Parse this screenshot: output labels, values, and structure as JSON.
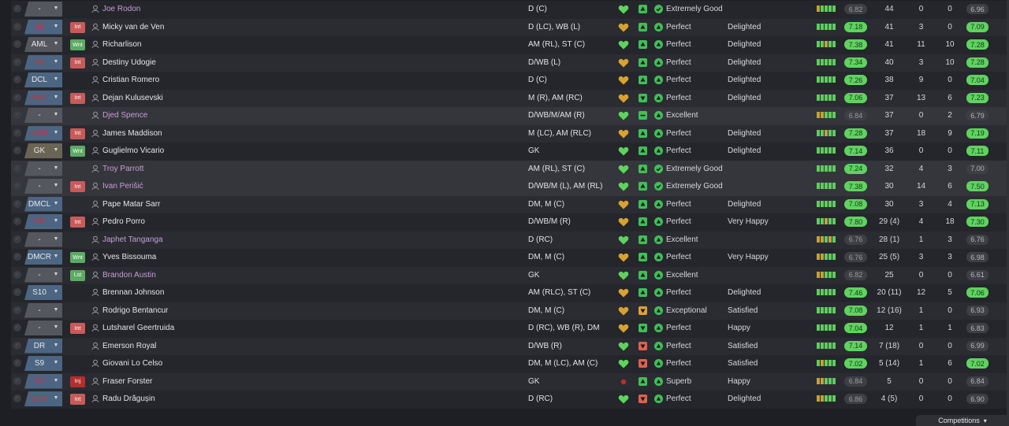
{
  "colors": {
    "heart": "#5ed35e",
    "heart_amber": "#d9a230",
    "morale_green": "#3fbf58",
    "morale_red": "#e06050",
    "morale_amber": "#e0a030",
    "rating_green": "#5fd35f",
    "loan_name": "#c89ed8"
  },
  "footer": {
    "competitions_label": "Competitions"
  },
  "rows": [
    {
      "position": "-",
      "pos_style": "grey",
      "badge": "",
      "name": "Joe Rodon",
      "loan": true,
      "positions": "D (C)",
      "heart": "green",
      "morale": "up",
      "morale_color": "green",
      "cond_icon": "check",
      "condition": "Extremely Good",
      "happiness": "",
      "form": [
        "y",
        "g",
        "g",
        "g",
        "g"
      ],
      "rating": "6.82",
      "rating_hi": false,
      "apps": "44",
      "goals": "0",
      "assists": "0",
      "avg": "6.96",
      "avg_hi": false
    },
    {
      "position": "SB",
      "pos_style": "red",
      "badge": "Int",
      "name": "Micky van de Ven",
      "loan": false,
      "positions": "D (LC), WB (L)",
      "heart": "amber",
      "morale": "up",
      "morale_color": "green",
      "cond_icon": "up",
      "condition": "Perfect",
      "happiness": "Delighted",
      "form": [
        "g",
        "g",
        "g",
        "g",
        "g"
      ],
      "rating": "7.18",
      "rating_hi": true,
      "apps": "41",
      "goals": "3",
      "assists": "0",
      "avg": "7.09",
      "avg_hi": true
    },
    {
      "position": "AML",
      "pos_style": "grey",
      "badge": "Wnt",
      "name": "Richarlison",
      "loan": false,
      "positions": "AM (RL), ST (C)",
      "heart": "green",
      "morale": "up",
      "morale_color": "green",
      "cond_icon": "up",
      "condition": "Perfect",
      "happiness": "Delighted",
      "form": [
        "g",
        "g",
        "y",
        "g",
        "g"
      ],
      "rating": "7.38",
      "rating_hi": true,
      "apps": "41",
      "goals": "11",
      "assists": "10",
      "avg": "7.28",
      "avg_hi": true
    },
    {
      "position": "IW",
      "pos_style": "red",
      "badge": "Int",
      "name": "Destiny Udogie",
      "loan": false,
      "positions": "D/WB (L)",
      "heart": "amber",
      "morale": "up",
      "morale_color": "green",
      "cond_icon": "up",
      "condition": "Perfect",
      "happiness": "Delighted",
      "form": [
        "g",
        "g",
        "g",
        "g",
        "g"
      ],
      "rating": "7.34",
      "rating_hi": true,
      "apps": "40",
      "goals": "3",
      "assists": "10",
      "avg": "7.28",
      "avg_hi": true
    },
    {
      "position": "DCL",
      "pos_style": "blue",
      "badge": "",
      "name": "Cristian Romero",
      "loan": false,
      "positions": "D (C)",
      "heart": "amber",
      "morale": "up",
      "morale_color": "green",
      "cond_icon": "up",
      "condition": "Perfect",
      "happiness": "Delighted",
      "form": [
        "g",
        "g",
        "g",
        "g",
        "g"
      ],
      "rating": "7.26",
      "rating_hi": true,
      "apps": "38",
      "goals": "9",
      "assists": "0",
      "avg": "7.04",
      "avg_hi": true
    },
    {
      "position": "AMC",
      "pos_style": "red",
      "badge": "Int",
      "name": "Dejan Kulusevski",
      "loan": false,
      "positions": "M (R), AM (RC)",
      "heart": "amber",
      "morale": "down",
      "morale_color": "green",
      "cond_icon": "up",
      "condition": "Perfect",
      "happiness": "Delighted",
      "form": [
        "g",
        "g",
        "g",
        "g",
        "g"
      ],
      "rating": "7.06",
      "rating_hi": true,
      "apps": "37",
      "goals": "13",
      "assists": "6",
      "avg": "7.23",
      "avg_hi": true
    },
    {
      "position": "-",
      "pos_style": "grey",
      "badge": "",
      "name": "Djed Spence",
      "loan": true,
      "positions": "D/WB/M/AM (R)",
      "heart": "green",
      "morale": "flat",
      "morale_color": "green",
      "cond_icon": "up",
      "condition": "Excellent",
      "happiness": "",
      "form": [
        "y",
        "y",
        "g",
        "g",
        "g"
      ],
      "rating": "6.84",
      "rating_hi": false,
      "apps": "37",
      "goals": "0",
      "assists": "2",
      "avg": "6.79",
      "avg_hi": false
    },
    {
      "position": "AMR",
      "pos_style": "red",
      "badge": "Int",
      "name": "James Maddison",
      "loan": false,
      "positions": "M (LC), AM (RLC)",
      "heart": "amber",
      "morale": "up",
      "morale_color": "green",
      "cond_icon": "up",
      "condition": "Perfect",
      "happiness": "Delighted",
      "form": [
        "g",
        "g",
        "y",
        "g",
        "g"
      ],
      "rating": "7.28",
      "rating_hi": true,
      "apps": "37",
      "goals": "18",
      "assists": "9",
      "avg": "7.19",
      "avg_hi": true
    },
    {
      "position": "GK",
      "pos_style": "brown",
      "badge": "Wnt",
      "name": "Guglielmo Vicario",
      "loan": false,
      "positions": "GK",
      "heart": "green",
      "morale": "up",
      "morale_color": "green",
      "cond_icon": "up",
      "condition": "Perfect",
      "happiness": "Delighted",
      "form": [
        "g",
        "g",
        "g",
        "g",
        "g"
      ],
      "rating": "7.14",
      "rating_hi": true,
      "apps": "36",
      "goals": "0",
      "assists": "0",
      "avg": "7.11",
      "avg_hi": true
    },
    {
      "position": "-",
      "pos_style": "grey",
      "badge": "",
      "name": "Troy Parrott",
      "loan": true,
      "positions": "AM (RL), ST (C)",
      "heart": "green",
      "morale": "up",
      "morale_color": "green",
      "cond_icon": "check",
      "condition": "Extremely Good",
      "happiness": "",
      "form": [
        "g",
        "g",
        "g",
        "g",
        "g"
      ],
      "rating": "7.24",
      "rating_hi": true,
      "apps": "32",
      "goals": "4",
      "assists": "3",
      "avg": "7.00",
      "avg_hi": false
    },
    {
      "position": "-",
      "pos_style": "grey",
      "badge": "Int",
      "name": "Ivan Perišić",
      "loan": true,
      "positions": "D/WB/M (L), AM (RL)",
      "heart": "green",
      "morale": "up",
      "morale_color": "green",
      "cond_icon": "check",
      "condition": "Extremely Good",
      "happiness": "",
      "form": [
        "g",
        "g",
        "g",
        "g",
        "g"
      ],
      "rating": "7.38",
      "rating_hi": true,
      "apps": "30",
      "goals": "14",
      "assists": "6",
      "avg": "7.50",
      "avg_hi": true
    },
    {
      "position": "DMCL",
      "pos_style": "blue",
      "badge": "",
      "name": "Pape Matar Sarr",
      "loan": false,
      "positions": "DM, M (C)",
      "heart": "amber",
      "morale": "up",
      "morale_color": "green",
      "cond_icon": "up",
      "condition": "Perfect",
      "happiness": "Delighted",
      "form": [
        "g",
        "g",
        "g",
        "g",
        "g"
      ],
      "rating": "7.08",
      "rating_hi": true,
      "apps": "30",
      "goals": "3",
      "assists": "4",
      "avg": "7.13",
      "avg_hi": true
    },
    {
      "position": "SB",
      "pos_style": "red",
      "badge": "Int",
      "name": "Pedro Porro",
      "loan": false,
      "positions": "D/WB/M (R)",
      "heart": "amber",
      "morale": "up",
      "morale_color": "green",
      "cond_icon": "up",
      "condition": "Perfect",
      "happiness": "Very Happy",
      "form": [
        "g",
        "g",
        "y",
        "g",
        "g"
      ],
      "rating": "7.80",
      "rating_hi": true,
      "apps": "29 (4)",
      "goals": "4",
      "assists": "18",
      "avg": "7.30",
      "avg_hi": true
    },
    {
      "position": "-",
      "pos_style": "grey",
      "badge": "",
      "name": "Japhet Tanganga",
      "loan": true,
      "positions": "D (RC)",
      "heart": "green",
      "morale": "up",
      "morale_color": "green",
      "cond_icon": "up",
      "condition": "Excellent",
      "happiness": "",
      "form": [
        "y",
        "y",
        "g",
        "y",
        "g"
      ],
      "rating": "6.76",
      "rating_hi": false,
      "apps": "28 (1)",
      "goals": "1",
      "assists": "3",
      "avg": "6.76",
      "avg_hi": false
    },
    {
      "position": "DMCR",
      "pos_style": "blue",
      "badge": "Wnt",
      "name": "Yves Bissouma",
      "loan": false,
      "positions": "DM, M (C)",
      "heart": "amber",
      "morale": "up",
      "morale_color": "green",
      "cond_icon": "up",
      "condition": "Perfect",
      "happiness": "Very Happy",
      "form": [
        "y",
        "y",
        "g",
        "g",
        "g"
      ],
      "rating": "6.76",
      "rating_hi": false,
      "apps": "25 (5)",
      "goals": "3",
      "assists": "3",
      "avg": "6.98",
      "avg_hi": false
    },
    {
      "position": "-",
      "pos_style": "grey",
      "badge": "Lst",
      "name": "Brandon Austin",
      "loan": true,
      "positions": "GK",
      "heart": "green",
      "morale": "up",
      "morale_color": "green",
      "cond_icon": "up",
      "condition": "Excellent",
      "happiness": "",
      "form": [
        "y",
        "y",
        "g",
        "g",
        "g"
      ],
      "rating": "6.82",
      "rating_hi": false,
      "apps": "25",
      "goals": "0",
      "assists": "0",
      "avg": "6.61",
      "avg_hi": false
    },
    {
      "position": "S10",
      "pos_style": "blue",
      "badge": "",
      "name": "Brennan Johnson",
      "loan": false,
      "positions": "AM (RLC), ST (C)",
      "heart": "amber",
      "morale": "up",
      "morale_color": "green",
      "cond_icon": "up",
      "condition": "Perfect",
      "happiness": "Delighted",
      "form": [
        "g",
        "g",
        "g",
        "g",
        "g"
      ],
      "rating": "7.46",
      "rating_hi": true,
      "apps": "20 (11)",
      "goals": "12",
      "assists": "5",
      "avg": "7.06",
      "avg_hi": true
    },
    {
      "position": "-",
      "pos_style": "grey",
      "badge": "",
      "name": "Rodrigo Bentancur",
      "loan": false,
      "positions": "DM, M (C)",
      "heart": "amber",
      "morale": "down",
      "morale_color": "amber",
      "cond_icon": "up",
      "condition": "Exceptional",
      "happiness": "Satisfied",
      "form": [
        "g",
        "g",
        "g",
        "g",
        "g"
      ],
      "rating": "7.08",
      "rating_hi": true,
      "apps": "12 (16)",
      "goals": "1",
      "assists": "0",
      "avg": "6.93",
      "avg_hi": false
    },
    {
      "position": "-",
      "pos_style": "grey",
      "badge": "Int",
      "name": "Lutsharel Geertruida",
      "loan": false,
      "positions": "D (RC), WB (R), DM",
      "heart": "amber",
      "morale": "down",
      "morale_color": "green",
      "cond_icon": "up",
      "condition": "Perfect",
      "happiness": "Happy",
      "form": [
        "g",
        "g",
        "g",
        "g",
        "g"
      ],
      "rating": "7.04",
      "rating_hi": true,
      "apps": "12",
      "goals": "1",
      "assists": "1",
      "avg": "6.83",
      "avg_hi": false
    },
    {
      "position": "DR",
      "pos_style": "blue",
      "badge": "",
      "name": "Emerson Royal",
      "loan": false,
      "positions": "D/WB (R)",
      "heart": "green",
      "morale": "down",
      "morale_color": "red",
      "cond_icon": "up",
      "condition": "Perfect",
      "happiness": "Satisfied",
      "form": [
        "g",
        "g",
        "g",
        "g",
        "g"
      ],
      "rating": "7.14",
      "rating_hi": true,
      "apps": "7 (18)",
      "goals": "0",
      "assists": "0",
      "avg": "6.99",
      "avg_hi": false
    },
    {
      "position": "S9",
      "pos_style": "blue",
      "badge": "",
      "name": "Giovani Lo Celso",
      "loan": false,
      "positions": "DM, M (LC), AM (C)",
      "heart": "green",
      "morale": "down",
      "morale_color": "red",
      "cond_icon": "up",
      "condition": "Perfect",
      "happiness": "Satisfied",
      "form": [
        "g",
        "y",
        "g",
        "g",
        "g"
      ],
      "rating": "7.02",
      "rating_hi": true,
      "apps": "5 (14)",
      "goals": "1",
      "assists": "6",
      "avg": "7.02",
      "avg_hi": true
    },
    {
      "position": "ST",
      "pos_style": "red",
      "badge": "Inj",
      "name": "Fraser Forster",
      "loan": false,
      "positions": "GK",
      "heart": "dot",
      "morale": "up",
      "morale_color": "green",
      "cond_icon": "up",
      "condition": "Superb",
      "happiness": "Happy",
      "form": [
        "y",
        "y",
        "g",
        "g",
        "g"
      ],
      "rating": "6.84",
      "rating_hi": false,
      "apps": "5",
      "goals": "0",
      "assists": "0",
      "avg": "6.84",
      "avg_hi": false
    },
    {
      "position": "DCR",
      "pos_style": "red",
      "badge": "Int",
      "name": "Radu Drăgușin",
      "loan": false,
      "positions": "D (RC)",
      "heart": "green",
      "morale": "down",
      "morale_color": "red",
      "cond_icon": "up",
      "condition": "Perfect",
      "happiness": "Delighted",
      "form": [
        "y",
        "y",
        "g",
        "g",
        "g"
      ],
      "rating": "6.86",
      "rating_hi": false,
      "apps": "4 (5)",
      "goals": "0",
      "assists": "0",
      "avg": "6.90",
      "avg_hi": false
    }
  ]
}
